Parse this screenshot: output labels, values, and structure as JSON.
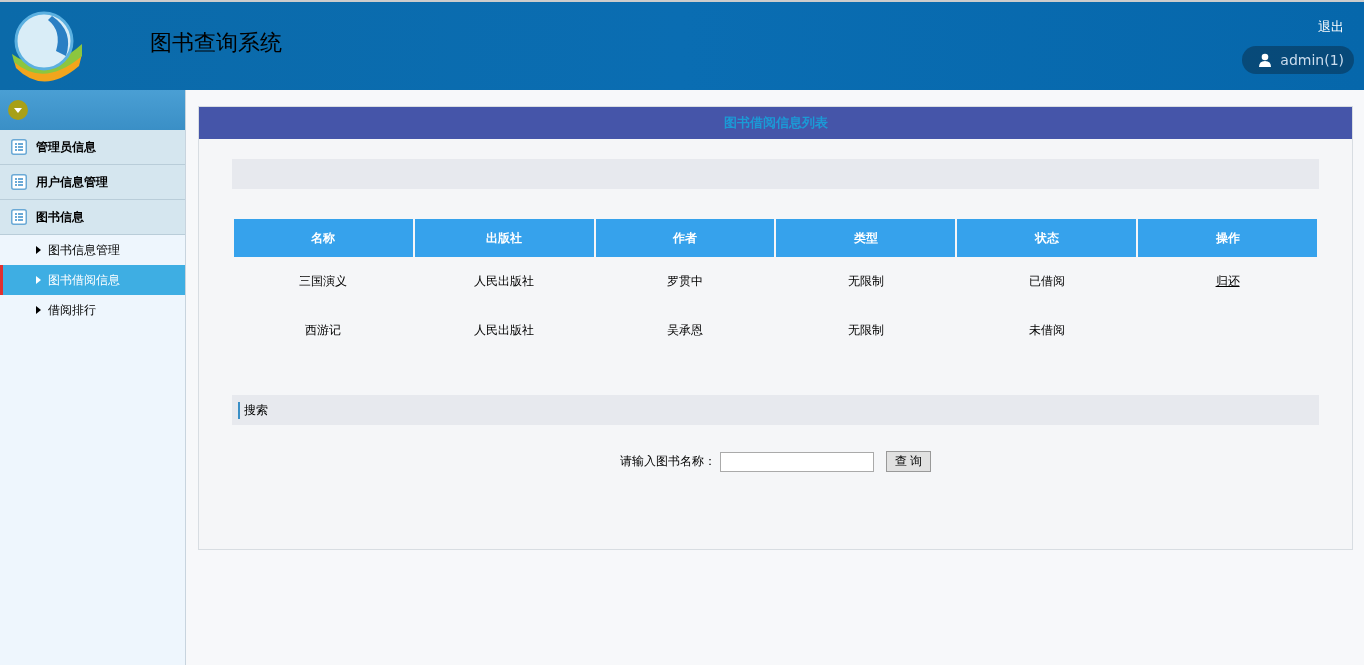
{
  "header": {
    "title": "图书查询系统",
    "logout": "退出",
    "user": "admin(1)"
  },
  "sidebar": {
    "groups": [
      {
        "label": "管理员信息"
      },
      {
        "label": "用户信息管理"
      },
      {
        "label": "图书信息",
        "children": [
          {
            "label": "图书信息管理",
            "selected": false
          },
          {
            "label": "图书借阅信息",
            "selected": true
          },
          {
            "label": "借阅排行",
            "selected": false
          }
        ]
      }
    ]
  },
  "panel": {
    "title": "图书借阅信息列表",
    "table": {
      "columns": [
        "名称",
        "出版社",
        "作者",
        "类型",
        "状态",
        "操作"
      ],
      "rows": [
        {
          "cells": [
            "三国演义",
            "人民出版社",
            "罗贯中",
            "无限制",
            "已借阅"
          ],
          "action": "归还"
        },
        {
          "cells": [
            "西游记",
            "人民出版社",
            "吴承恩",
            "无限制",
            "未借阅"
          ]
        }
      ]
    },
    "search": {
      "heading": "搜索",
      "label": "请输入图书名称：",
      "button": "查 询"
    }
  }
}
